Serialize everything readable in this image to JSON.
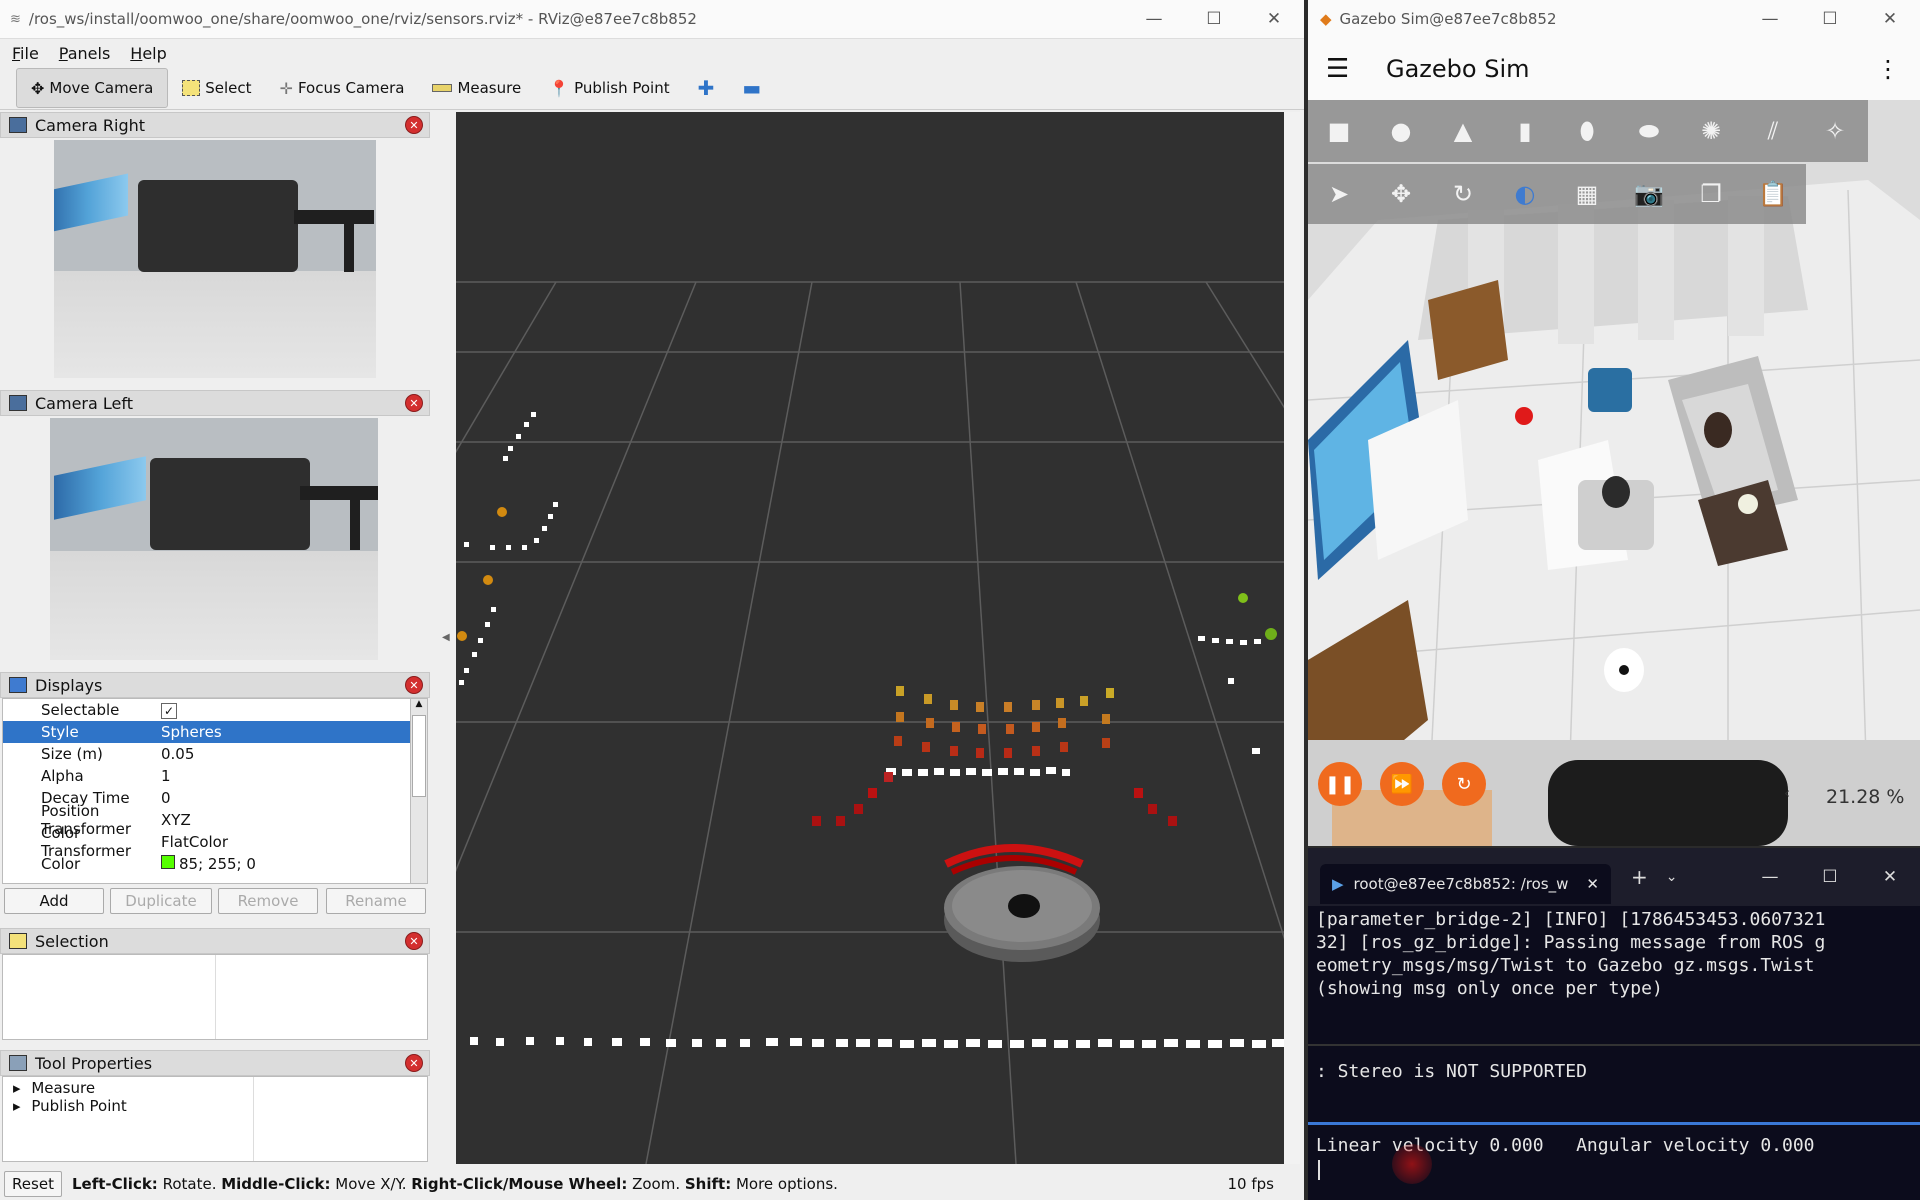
{
  "rviz": {
    "title": "/ros_ws/install/oomwoo_one/share/oomwoo_one/rviz/sensors.rviz* - RViz@e87ee7c8b852",
    "menu": [
      "File",
      "Panels",
      "Help"
    ],
    "tools": [
      {
        "label": "Move Camera",
        "icon": "move-camera-icon"
      },
      {
        "label": "Select",
        "icon": "select-icon"
      },
      {
        "label": "Focus Camera",
        "icon": "focus-camera-icon"
      },
      {
        "label": "Measure",
        "icon": "measure-icon"
      },
      {
        "label": "Publish Point",
        "icon": "publish-point-icon"
      }
    ],
    "panels": {
      "camera_right": "Camera Right",
      "camera_left": "Camera Left",
      "displays": "Displays",
      "selection": "Selection",
      "tool_properties": "Tool Properties"
    },
    "display_props": [
      {
        "key": "Selectable",
        "value": "✓"
      },
      {
        "key": "Style",
        "value": "Spheres"
      },
      {
        "key": "Size (m)",
        "value": "0.05"
      },
      {
        "key": "Alpha",
        "value": "1"
      },
      {
        "key": "Decay Time",
        "value": "0"
      },
      {
        "key": "Position Transformer",
        "value": "XYZ"
      },
      {
        "key": "Color Transformer",
        "value": "FlatColor"
      },
      {
        "key": "Color",
        "value": "85; 255; 0"
      }
    ],
    "display_buttons": [
      "Add",
      "Duplicate",
      "Remove",
      "Rename"
    ],
    "tool_props": [
      "Measure",
      "Publish Point"
    ],
    "status": {
      "reset": "Reset",
      "k1": "Left-Click:",
      "v1": " Rotate. ",
      "k2": "Middle-Click:",
      "v2": " Move X/Y. ",
      "k3": "Right-Click/Mouse Wheel:",
      "v3": " Zoom. ",
      "k4": "Shift:",
      "v4": " More options.",
      "fps": "10 fps"
    },
    "colors": {
      "selection": "#2f74c8",
      "point_color": "#55ff00"
    }
  },
  "gazebo": {
    "window_title": "Gazebo Sim@e87ee7c8b852",
    "app_title": "Gazebo Sim",
    "zoom": "21.28 %"
  },
  "terminal": {
    "tab": "root@e87ee7c8b852: /ros_w",
    "lines": [
      "[parameter_bridge-2] [INFO] [1786453453.0607321",
      "32] [ros_gz_bridge]: Passing message from ROS g",
      "eometry_msgs/msg/Twist to Gazebo gz.msgs.Twist",
      "(showing msg only once per type)"
    ],
    "stereo": ": Stereo is NOT SUPPORTED",
    "velocity": "Linear velocity 0.000   Angular velocity 0.000"
  }
}
